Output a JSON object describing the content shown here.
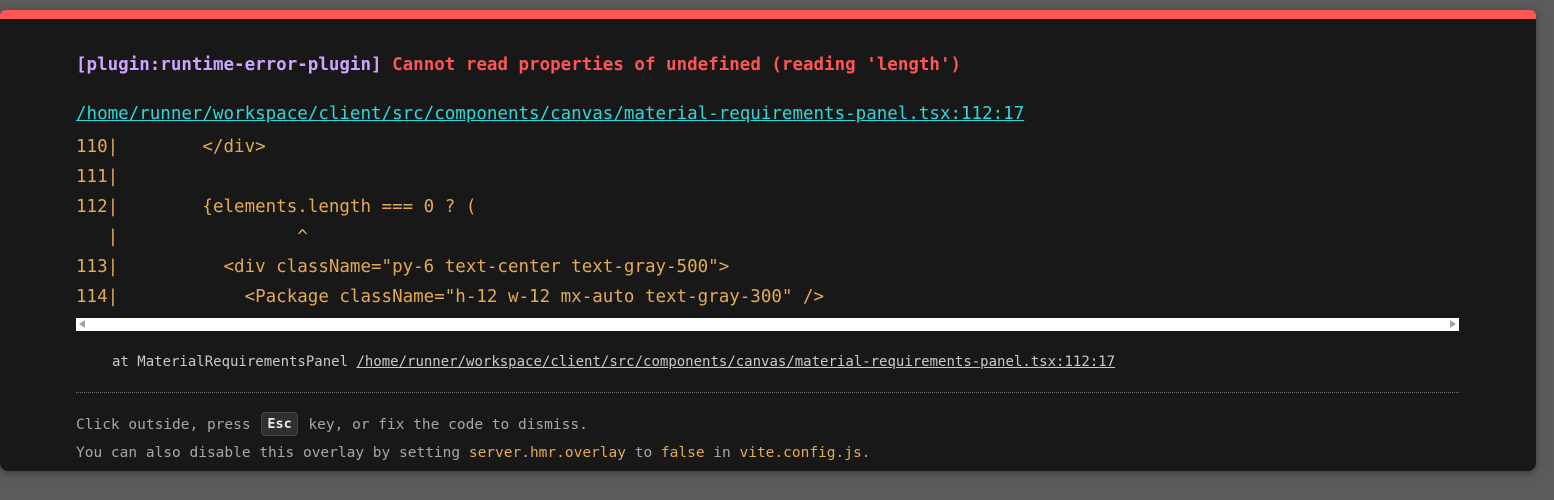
{
  "error": {
    "plugin": "[plugin:runtime-error-plugin]",
    "message": "Cannot read properties of undefined (reading 'length')",
    "file": "/home/runner/workspace/client/src/components/canvas/material-requirements-panel.tsx:112:17"
  },
  "frame": {
    "lines": [
      "110|        </div>",
      "111|",
      "112|        {elements.length === 0 ? (",
      "   |                 ^",
      "113|          <div className=\"py-6 text-center text-gray-500\">",
      "114|            <Package className=\"h-12 w-12 mx-auto text-gray-300\" />"
    ]
  },
  "stack": {
    "prefix": "at MaterialRequirementsPanel",
    "file": "/home/runner/workspace/client/src/components/canvas/material-requirements-panel.tsx:112:17"
  },
  "tip": {
    "line1_before": "Click outside, press ",
    "key": "Esc",
    "line1_after": " key, or fix the code to dismiss.",
    "line2_a": "You can also disable this overlay by setting ",
    "setting": "server.hmr.overlay",
    "line2_b": " to ",
    "value": "false",
    "line2_c": " in ",
    "config_file": "vite.config.js",
    "line2_d": "."
  },
  "colors": {
    "accent_red": "#ff5555",
    "plugin_purple": "#cfa3ff",
    "link_cyan": "#2dd9da",
    "code_yellow": "#e2aa53",
    "background": "#181818"
  }
}
